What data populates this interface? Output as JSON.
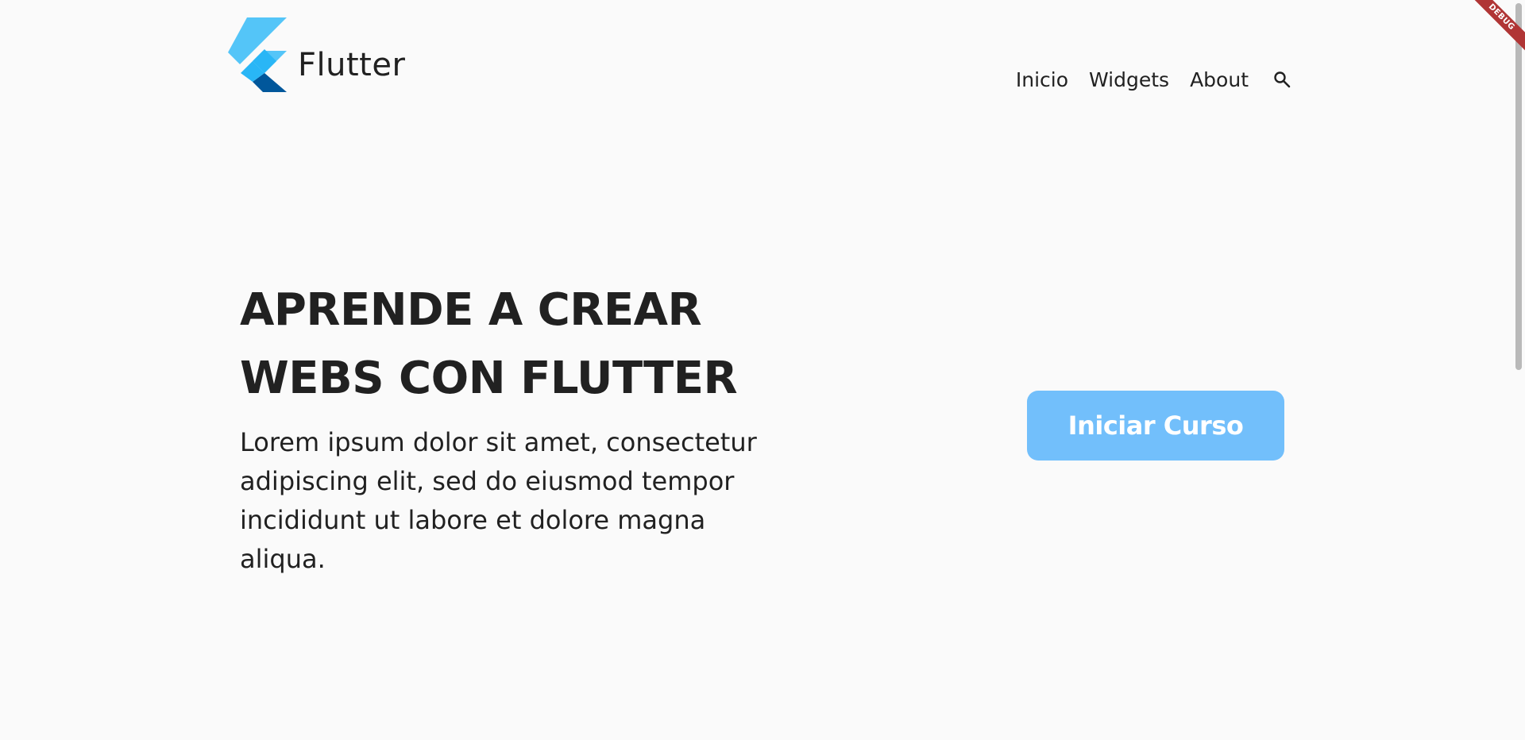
{
  "header": {
    "brand_name": "Flutter",
    "logo_icon": "flutter-logo",
    "nav": {
      "items": [
        {
          "label": "Inicio"
        },
        {
          "label": "Widgets"
        },
        {
          "label": "About"
        }
      ],
      "search_icon": "search-icon"
    }
  },
  "hero": {
    "title_lines": [
      "APRENDE A CREAR",
      "WEBS CON FLUTTER"
    ],
    "description": "Lorem ipsum dolor sit amet, consectetur adipiscing elit, sed do eiusmod tempor incididunt ut labore et dolore magna aliqua.",
    "cta_label": "Iniciar Curso"
  },
  "debug_banner": "DEBUG",
  "colors": {
    "background": "#fafafa",
    "text": "#212121",
    "button": "#72bffb",
    "button_text": "#ffffff",
    "debug_banner": "#b03535",
    "logo_light": "#54c5f8",
    "logo_mid": "#29b6f6",
    "logo_dark": "#01579b"
  }
}
